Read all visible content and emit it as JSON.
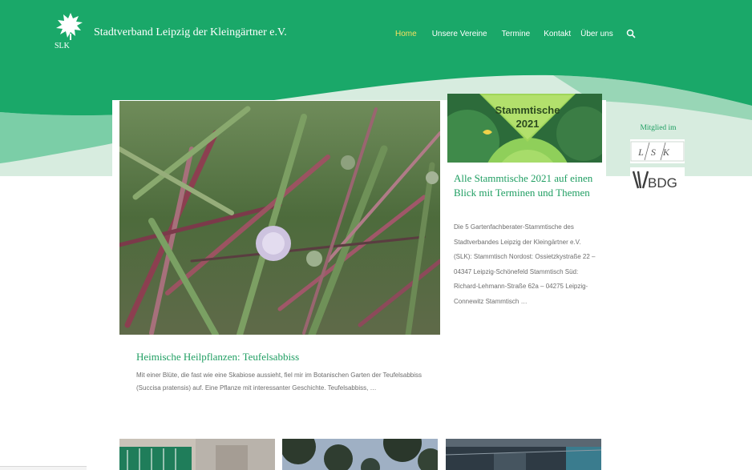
{
  "header": {
    "site_title": "Stadtverband Leipzig der Kleingärtner e.V.",
    "logo_text": "SLK",
    "brand_color": "#1aa869",
    "accent_color": "#f6e05f"
  },
  "nav": {
    "items": [
      {
        "label": "Home",
        "active": true
      },
      {
        "label": "Unsere Vereine",
        "active": false
      },
      {
        "label": "Termine",
        "active": false
      },
      {
        "label": "Kontakt",
        "active": false
      },
      {
        "label": "Über uns",
        "active": false
      }
    ],
    "search_icon": "search-icon"
  },
  "feature_post": {
    "title": "Heimische Heilpflanzen: Teufelsabbiss",
    "excerpt": "Mit einer Blüte, die fast wie eine Skabiose aussieht, fiel mir im Botanischen Garten der Teufelsabbiss (Succisa pratensis) auf. Eine Pflanze mit interessanter Geschichte. Teufelsabbiss, …"
  },
  "side_post": {
    "image_text_line1": "Stammtische",
    "image_text_line2": "2021",
    "title": "Alle Stammtische 2021 auf einen Blick mit Terminen und Themen",
    "excerpt": "Die 5 Gartenfachberater-Stammtische des Stadtverbandes Leipzig der Kleingärtner e.V. (SLK): Stammtisch Nordost: Ossietzkystraße 22 – 04347 Leipzig-Schönefeld Stammtisch Süd: Richard-Lehmann-Straße 62a – 04275 Leipzig-Connewitz Stammtisch …"
  },
  "sidebar": {
    "member_label": "Mitglied im",
    "lsk_logo_text": "LSK",
    "bdg_logo_text": "BDG"
  }
}
